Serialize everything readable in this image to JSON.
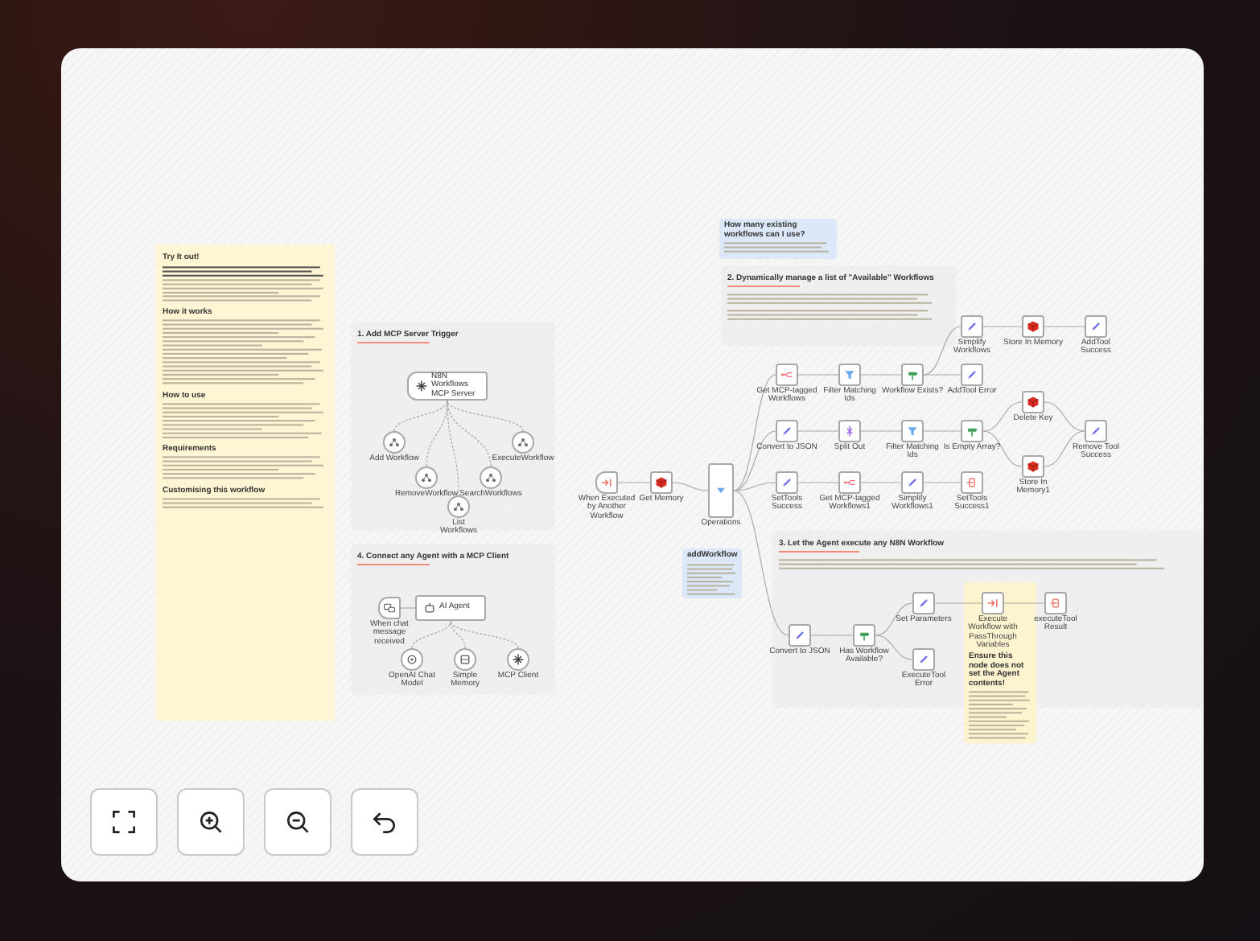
{
  "sticky_note": {
    "title": "Try It out!",
    "headings": [
      "How it works",
      "How to use",
      "Requirements",
      "Customising this workflow"
    ]
  },
  "sections": [
    {
      "title": "1. Add MCP Server Trigger"
    },
    {
      "title": "4. Connect any Agent with a MCP Client"
    },
    {
      "title": "2. Dynamically manage a list of \"Available\" Workflows"
    },
    {
      "title": "3. Let the Agent execute any N8N Workflow"
    }
  ],
  "notes": [
    {
      "kind": "info",
      "title": "How many existing workflows can I use?"
    },
    {
      "kind": "info",
      "title": "addWorkflow"
    },
    {
      "kind": "warning",
      "title": "Ensure this node does not set the Agent contents!"
    }
  ],
  "nodes": [
    {
      "kind": "mcp",
      "label": "N8N Workflows MCP Server"
    },
    {
      "kind": "tool",
      "label": "Add Workflow"
    },
    {
      "kind": "tool",
      "label": "RemoveWorkflow"
    },
    {
      "kind": "tool",
      "label": "List Workflows"
    },
    {
      "kind": "tool",
      "label": "SearchWorkflows"
    },
    {
      "kind": "tool",
      "label": "ExecuteWorkflow"
    },
    {
      "kind": "chat",
      "label": "When chat message received"
    },
    {
      "kind": "agent",
      "label": "AI Agent"
    },
    {
      "kind": "model",
      "label": "OpenAI Chat Model"
    },
    {
      "kind": "memory",
      "label": "Simple Memory"
    },
    {
      "kind": "mcpclient",
      "label": "MCP Client"
    },
    {
      "kind": "trigger",
      "label": "When Executed by Another Workflow"
    },
    {
      "kind": "redis",
      "label": "Get Memory"
    },
    {
      "kind": "switch",
      "label": "Operations"
    },
    {
      "kind": "n8n",
      "label": "Get MCP-tagged Workflows"
    },
    {
      "kind": "filter",
      "label": "Filter Matching Ids"
    },
    {
      "kind": "if",
      "label": "Workflow Exists?"
    },
    {
      "kind": "set",
      "label": "Simplify Workflows"
    },
    {
      "kind": "redis",
      "label": "Store In Memory"
    },
    {
      "kind": "set",
      "label": "AddTool Success"
    },
    {
      "kind": "set",
      "label": "AddTool Error"
    },
    {
      "kind": "set",
      "label": "Convert to JSON"
    },
    {
      "kind": "split",
      "label": "Split Out"
    },
    {
      "kind": "filter",
      "label": "Filter Matching Ids"
    },
    {
      "kind": "if",
      "label": "Is Empty Array?"
    },
    {
      "kind": "redis",
      "label": "Delete Key"
    },
    {
      "kind": "redis",
      "label": "Store In Memory1"
    },
    {
      "kind": "set",
      "label": "Remove Tool Success"
    },
    {
      "kind": "set",
      "label": "SetTools Success"
    },
    {
      "kind": "n8n",
      "label": "Get MCP-tagged Workflows1"
    },
    {
      "kind": "set",
      "label": "Simplify Workflows1"
    },
    {
      "kind": "code",
      "label": "SetTools Success1"
    },
    {
      "kind": "set",
      "label": "Convert to JSON"
    },
    {
      "kind": "if",
      "label": "Has Workflow Available?"
    },
    {
      "kind": "set",
      "label": "Set Parameters"
    },
    {
      "kind": "set",
      "label": "ExecuteTool Error"
    },
    {
      "kind": "execute",
      "label": "Execute Workflow with PassThrough Variables"
    },
    {
      "kind": "code",
      "label": "executeTool Result"
    }
  ],
  "controls": [
    {
      "kind": "fit"
    },
    {
      "kind": "zoom-in"
    },
    {
      "kind": "zoom-out"
    },
    {
      "kind": "undo"
    }
  ]
}
